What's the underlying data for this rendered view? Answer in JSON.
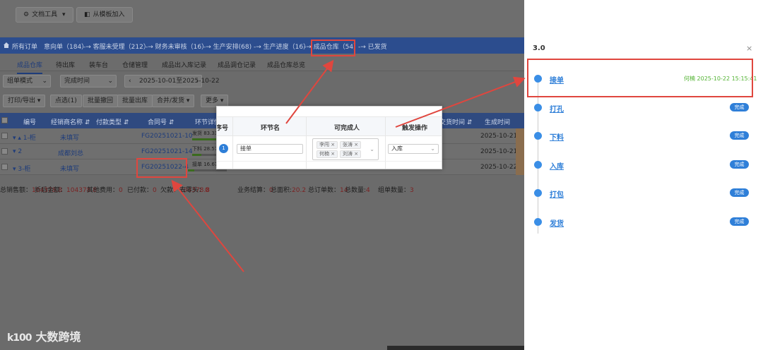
{
  "toolbar": {
    "doc_tools": "文档工具",
    "from_template": "从模板加入",
    "chevron": "▾"
  },
  "nav": {
    "items": [
      {
        "label": "所有订单"
      },
      {
        "label": "意向单（184）"
      },
      {
        "label": "-→ 客服未受理（212）"
      },
      {
        "label": "-→ 财务未审核（16）"
      },
      {
        "label": "-→ 生产安排(68)"
      },
      {
        "label": "-→ 生产进度（16）"
      },
      {
        "label": "-→ 成品仓库（54）"
      },
      {
        "label": "-→ 已发货"
      }
    ]
  },
  "subtabs": [
    "成品仓库",
    "待出库",
    "装车台",
    "仓储管理",
    "成品出入库记录",
    "成品调仓记录",
    "成品仓库总览"
  ],
  "filters": {
    "mode": "组单模式",
    "time_type": "完成时间",
    "date_range": "2025-10-01至2025-10-22",
    "nav_prev": "‹",
    "nav_next": "›"
  },
  "actions": [
    "打印/导出 ▾",
    "点选(1)",
    "批量撤回",
    "批量出库",
    "合并/发货 ▾",
    "更多 ▾"
  ],
  "table": {
    "headers": [
      "编号",
      "经销商名称 ⇵",
      "付款类型 ⇵",
      "合同号 ⇵",
      "环节详情",
      "交货时间 ⇵",
      "生成时间"
    ],
    "rows": [
      {
        "id": "▾ ▴ 1-柜",
        "dealer": "未填写",
        "contract": "FG20251021-10",
        "stage": "发货 83.33",
        "progress": 0.83,
        "created": "2025-10-21"
      },
      {
        "id": "▾ 2",
        "dealer": "成都刘总",
        "contract": "FG20251021-14",
        "stage": "下料 28.57",
        "progress": 0.29,
        "created": "2025-10-21"
      },
      {
        "id": "▾ 3-柜",
        "dealer": "未填写",
        "contract": "FG20251022-4",
        "stage": "接单 16.67",
        "progress": 0.17,
        "created": "2025-10-22"
      }
    ]
  },
  "summary": [
    {
      "label": "总销售额：",
      "value": "104378.8"
    },
    {
      "label": "折后金额：",
      "value": "104378.8"
    },
    {
      "label": "其他费用：",
      "value": "0"
    },
    {
      "label": "已付款：",
      "value": "0"
    },
    {
      "label": "欠款：",
      "value": "104378.8"
    },
    {
      "label": "去零头：",
      "value": "0"
    },
    {
      "label": "业务结算：",
      "value": "0"
    },
    {
      "label": "总面积:",
      "value": "20.2"
    },
    {
      "label": "总订单数：",
      "value": "14"
    },
    {
      "label": "总数量:",
      "value": "4"
    },
    {
      "label": "组单数量：",
      "value": "3"
    }
  ],
  "modal": {
    "headers": [
      "序号",
      "环节名",
      "可完成人",
      "触发操作"
    ],
    "row": {
      "index": "1",
      "name": "接单",
      "people": [
        "李闯 ×",
        "张涛 ×",
        "何楠 ×",
        "刘涛 ×"
      ],
      "trigger": "入库"
    }
  },
  "drawer": {
    "title": "3.0",
    "close": "×",
    "steps": [
      {
        "label": "接单",
        "time": "何楠 2025-10-22 15:15:41",
        "badge": ""
      },
      {
        "label": "打孔",
        "time": "",
        "badge": "完成"
      },
      {
        "label": "下料",
        "time": "",
        "badge": "完成"
      },
      {
        "label": "入库",
        "time": "",
        "badge": "完成"
      },
      {
        "label": "打包",
        "time": "",
        "badge": "完成"
      },
      {
        "label": "发货",
        "time": "",
        "badge": "完成"
      }
    ]
  },
  "watermark": {
    "logo": "k100",
    "text": "大数跨境"
  },
  "colors": {
    "primary": "#2f7fd8",
    "annotation": "#e0463e",
    "success": "#52b332"
  }
}
